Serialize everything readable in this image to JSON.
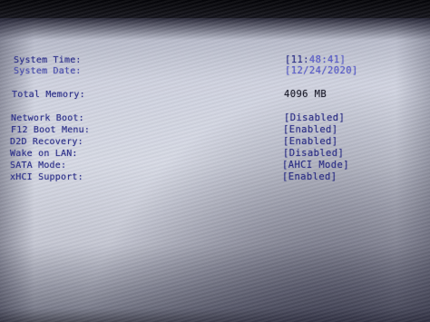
{
  "system_time": {
    "label": "System Time:",
    "open": "[11:",
    "rest": "48:41]"
  },
  "system_date": {
    "label": "System Date:",
    "value": "[12/24/2020]"
  },
  "total_memory": {
    "label": "Total Memory:",
    "value": "4096 MB"
  },
  "settings": [
    {
      "label": "Network Boot:",
      "value": "[Disabled]"
    },
    {
      "label": "F12 Boot Menu:",
      "value": "[Enabled]"
    },
    {
      "label": "D2D Recovery:",
      "value": "[Enabled]"
    },
    {
      "label": "Wake on LAN:",
      "value": "[Disabled]"
    },
    {
      "label": "SATA Mode:",
      "value": "[AHCI Mode]"
    },
    {
      "label": "xHCI Support:",
      "value": "[Enabled]"
    }
  ]
}
